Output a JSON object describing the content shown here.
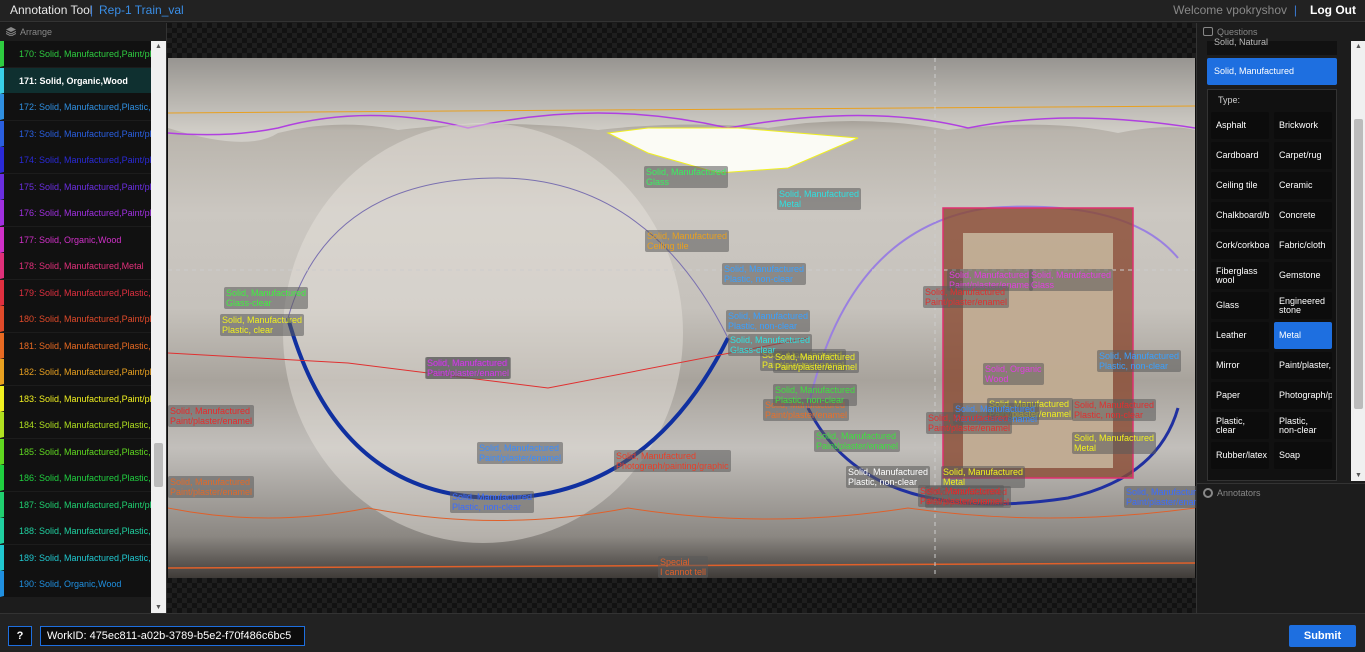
{
  "header": {
    "app_title": "Annotation Tool",
    "separator": "|",
    "project": "Rep-1 Train_val",
    "welcome": "Welcome vpokryshov",
    "logout": "Log Out"
  },
  "left_panel": {
    "title": "Arrange",
    "items": [
      {
        "label": "170: Solid, Manufactured,Paint/pl",
        "color": "#2ecc40"
      },
      {
        "label": "171: Solid, Organic,Wood",
        "color": "#39d0e8"
      },
      {
        "label": "172: Solid, Manufactured,Plastic,",
        "color": "#2f8fe0"
      },
      {
        "label": "173: Solid, Manufactured,Paint/pl",
        "color": "#2a5fe0"
      },
      {
        "label": "174: Solid, Manufactured,Paint/pl",
        "color": "#2a2ad8"
      },
      {
        "label": "175: Solid, Manufactured,Paint/pl",
        "color": "#6a2ee0"
      },
      {
        "label": "176: Solid, Manufactured,Paint/pl",
        "color": "#a030e0"
      },
      {
        "label": "177: Solid, Organic,Wood",
        "color": "#d030c8"
      },
      {
        "label": "178: Solid, Manufactured,Metal",
        "color": "#e0307a"
      },
      {
        "label": "179: Solid, Manufactured,Plastic,",
        "color": "#e03040"
      },
      {
        "label": "180: Solid, Manufactured,Paint/pl",
        "color": "#e04a2a"
      },
      {
        "label": "181: Solid, Manufactured,Plastic,",
        "color": "#e86a22"
      },
      {
        "label": "182: Solid, Manufactured,Paint/pl",
        "color": "#e8a020"
      },
      {
        "label": "183: Solid, Manufactured,Paint/pl",
        "color": "#f0f020"
      },
      {
        "label": "184: Solid, Manufactured,Plastic,",
        "color": "#b0e020"
      },
      {
        "label": "185: Solid, Manufactured,Plastic,",
        "color": "#60d820"
      },
      {
        "label": "186: Solid, Manufactured,Plastic,",
        "color": "#20d040"
      },
      {
        "label": "187: Solid, Manufactured,Paint/pl",
        "color": "#20d070"
      },
      {
        "label": "188: Solid, Manufactured,Plastic,",
        "color": "#20d0a0"
      },
      {
        "label": "189: Solid, Manufactured,Plastic,",
        "color": "#20c8d0"
      },
      {
        "label": "190: Solid, Organic,Wood",
        "color": "#2090e0"
      }
    ]
  },
  "viewer": {
    "labels": [
      {
        "text": "Special\nI cannot tell",
        "color": "#e0602a"
      },
      {
        "text": "Solid, Manufactured\nGlass",
        "color": "#3af060"
      },
      {
        "text": "Solid, Manufactured\nMetal",
        "color": "#30e0e0"
      },
      {
        "text": "Solid, Manufactured\nCeiling tile",
        "color": "#e8a020"
      },
      {
        "text": "Solid, Manufactured\nPlastic, non-clear",
        "color": "#3aa0ff"
      },
      {
        "text": "Solid, Manufactured\nGlass-clear",
        "color": "#40f040"
      },
      {
        "text": "Solid, Manufactured\nPlastic, clear",
        "color": "#f0f020"
      },
      {
        "text": "Solid, Manufactured\nPlastic, non-clear",
        "color": "#c040f0"
      },
      {
        "text": "Solid, Manufactured\nPaint/plaster/enamel",
        "color": "#d040e0"
      },
      {
        "text": "Solid, Manufactured\nPaint/plaster/enamel",
        "color": "#f0f020"
      },
      {
        "text": "Solid, Manufactured\nPaint/plaster/enamel",
        "color": "#e82a2a"
      },
      {
        "text": "Solid, Manufactured\nPaint/plaster/enamel",
        "color": "#3a8cff"
      },
      {
        "text": "Solid, Manufactured\nPhotograph/painting/graphic",
        "color": "#e8402a"
      },
      {
        "text": "Solid, Manufactured\nPlastic, non-clear",
        "color": "#3a6cff"
      },
      {
        "text": "Solid, Manufactured\nPaint/plaster/enamel",
        "color": "#e06a2a"
      },
      {
        "text": "Solid, Manufactured\nPlastic, non-clear",
        "color": "#3aa0ff"
      },
      {
        "text": "Solid, Manufactured\nGlass-clear",
        "color": "#30e0e0"
      },
      {
        "text": "Solid, Manufactured\nPaint/plaster/enamel",
        "color": "#f0f020"
      },
      {
        "text": "Solid, Manufactured\nPaint/plaster/enamel",
        "color": "#e8702a"
      },
      {
        "text": "Solid, Manufactured\nPlastic, non-clear",
        "color": "#40e040"
      },
      {
        "text": "Solid, Manufactured\nPaint/plaster/enamel",
        "color": "#40e040"
      },
      {
        "text": "Solid, Manufactured\nPlastic, non-clear",
        "color": "#ffffff"
      },
      {
        "text": "Solid, Manufactured\nMetal",
        "color": "#f0f020"
      },
      {
        "text": "Solid, Manufactured\nPaint/plaster/enamel",
        "color": "#e82a2a"
      },
      {
        "text": "Solid, Manufactured\nPaint/plaster/enamel",
        "color": "#e040e0"
      },
      {
        "text": "Solid, Manufactured\nGlass",
        "color": "#e040e0"
      },
      {
        "text": "Solid, Manufactured\nPaint/plaster/enamel",
        "color": "#e03030"
      },
      {
        "text": "Solid, Organic\nWood",
        "color": "#e040e0"
      },
      {
        "text": "Solid, Manufactured\nPaint/plaster/enamel",
        "color": "#f0f020"
      },
      {
        "text": "Solid, Manufactured\nPlastic, non-clear",
        "color": "#e03030"
      },
      {
        "text": "Solid, Manufactured\nMetal",
        "color": "#f0f020"
      },
      {
        "text": "Solid, Manufactured\nPaint/plaster/enamel",
        "color": "#3a8cff"
      },
      {
        "text": "Solid, Manufactured\nPlastic, non-clear",
        "color": "#3aa0ff"
      },
      {
        "text": "Solid, Manufactured\nPaint/plaster/enamel",
        "color": "#e03030"
      },
      {
        "text": "Solid, Manufactured\nPaint/plaster/enamel",
        "color": "#e82a2a"
      },
      {
        "text": "Solid, Manufactured\nPaint/plaster/enamel",
        "color": "#3a6cff"
      }
    ]
  },
  "right_panel": {
    "questions_title": "Questions",
    "top_option": "Solid, Natural",
    "selected_option": "Solid, Manufactured",
    "type_label": "Type:",
    "types": [
      {
        "label": "Asphalt",
        "selected": false
      },
      {
        "label": "Brickwork",
        "selected": false
      },
      {
        "label": "Cardboard",
        "selected": false
      },
      {
        "label": "Carpet/rug",
        "selected": false
      },
      {
        "label": "Ceiling tile",
        "selected": false
      },
      {
        "label": "Ceramic",
        "selected": false
      },
      {
        "label": "Chalkboard/b",
        "selected": false
      },
      {
        "label": "Concrete",
        "selected": false
      },
      {
        "label": "Cork/corkboa",
        "selected": false
      },
      {
        "label": "Fabric/cloth",
        "selected": false
      },
      {
        "label": "Fiberglass wool",
        "selected": false
      },
      {
        "label": "Gemstone",
        "selected": false
      },
      {
        "label": "Glass",
        "selected": false
      },
      {
        "label": "Engineered stone",
        "selected": false
      },
      {
        "label": "Leather",
        "selected": false
      },
      {
        "label": "Metal",
        "selected": true
      },
      {
        "label": "Mirror",
        "selected": false
      },
      {
        "label": "Paint/plaster,",
        "selected": false
      },
      {
        "label": "Paper",
        "selected": false
      },
      {
        "label": "Photograph/p",
        "selected": false
      },
      {
        "label": "Plastic, clear",
        "selected": false
      },
      {
        "label": "Plastic, non-clear",
        "selected": false
      },
      {
        "label": "Rubber/latex",
        "selected": false
      },
      {
        "label": "Soap",
        "selected": false
      }
    ],
    "annotators_title": "Annotators"
  },
  "footer": {
    "help": "?",
    "workid": "WorkID: 475ec811-a02b-3789-b5e2-f70f486c6bc5",
    "submit": "Submit"
  }
}
